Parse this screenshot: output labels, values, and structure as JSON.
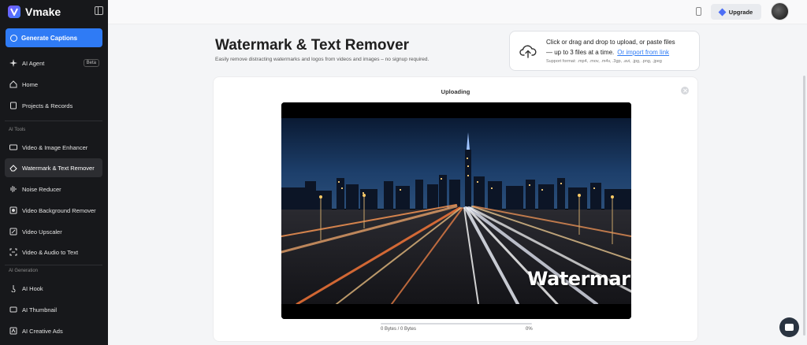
{
  "brand": {
    "name": "Vmake"
  },
  "sidebar": {
    "generate_label": "Generate Captions",
    "items_top": [
      {
        "label": "AI Agent",
        "badge": "Beta",
        "icon": "sparkle-icon"
      },
      {
        "label": "Home",
        "icon": "home-icon"
      },
      {
        "label": "Projects & Records",
        "icon": "records-icon"
      }
    ],
    "section_tools": "AI Tools",
    "tools": [
      {
        "label": "Video & Image Enhancer",
        "icon": "hd-icon"
      },
      {
        "label": "Watermark & Text Remover",
        "icon": "eraser-icon",
        "active": true
      },
      {
        "label": "Noise Reducer",
        "icon": "noise-icon"
      },
      {
        "label": "Video Background Remover",
        "icon": "background-icon"
      },
      {
        "label": "Video Upscaler",
        "icon": "upscale-icon"
      },
      {
        "label": "Video & Audio to Text",
        "icon": "transcribe-icon"
      }
    ],
    "section_generation": "AI Generation",
    "generation": [
      {
        "label": "AI Hook",
        "icon": "hook-icon"
      },
      {
        "label": "AI Thumbnail",
        "icon": "thumbnail-icon"
      },
      {
        "label": "AI Creative Ads",
        "icon": "ads-icon"
      }
    ]
  },
  "topbar": {
    "upgrade_label": "Upgrade"
  },
  "header": {
    "title": "Watermark & Text Remover",
    "subtitle": "Easily remove distracting watermarks and logos from videos and images – no signup required."
  },
  "upload": {
    "line1": "Click or drag and drop to upload, or paste files",
    "line2": "— up to 3 files at a time.",
    "link": "Or import from link",
    "formats": "Support format: .mp4, .mov, .m4v, .3gp, .avi, .jpg, .png, .jpeg"
  },
  "card": {
    "status": "Uploading",
    "watermark_text": "Watermarks",
    "bytes": "0 Bytes / 0 Bytes",
    "percent": "0%",
    "progress": 0
  },
  "colors": {
    "accent": "#2f7bf5",
    "sidebar_bg": "#17181b"
  }
}
